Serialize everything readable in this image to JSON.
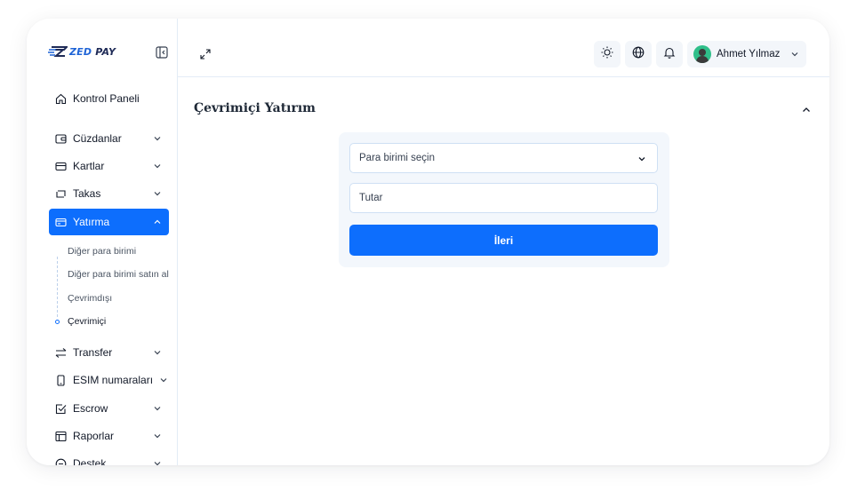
{
  "brand": {
    "logo_text_prefix": "ZED",
    "logo_text_suffix": " PAY",
    "accent": "#0d6efd"
  },
  "sidebar": {
    "items": [
      {
        "label": "Kontrol Paneli",
        "icon": "home-icon"
      },
      {
        "label": "Cüzdanlar",
        "icon": "wallet-icon"
      },
      {
        "label": "Kartlar",
        "icon": "credit-card-icon"
      },
      {
        "label": "Takas",
        "icon": "exchange-icon"
      },
      {
        "label": "Yatırma",
        "icon": "deposit-icon",
        "active": true
      },
      {
        "label": "Transfer",
        "icon": "transfer-arrows-icon"
      },
      {
        "label": "ESIM numaraları",
        "icon": "phone-icon"
      },
      {
        "label": "Escrow",
        "icon": "checkbox-icon"
      },
      {
        "label": "Raporlar",
        "icon": "table-icon"
      },
      {
        "label": "Destek",
        "icon": "support-icon"
      }
    ],
    "sub_items": [
      {
        "label": "Diğer para birimi"
      },
      {
        "label": "Diğer para birimi satın al"
      },
      {
        "label": "Çevrimdışı"
      },
      {
        "label": "Çevrimiçi",
        "current": true
      }
    ]
  },
  "topbar": {
    "icons": [
      "expand-icon",
      "sun-icon",
      "globe-icon",
      "bell-icon"
    ],
    "user": {
      "name": "Ahmet Yılmaz"
    }
  },
  "main": {
    "title": "Çevrimiçi Yatırım",
    "form": {
      "currency_placeholder": "Para birimi seçin",
      "amount_placeholder": "Tutar",
      "submit_label": "İleri"
    }
  }
}
